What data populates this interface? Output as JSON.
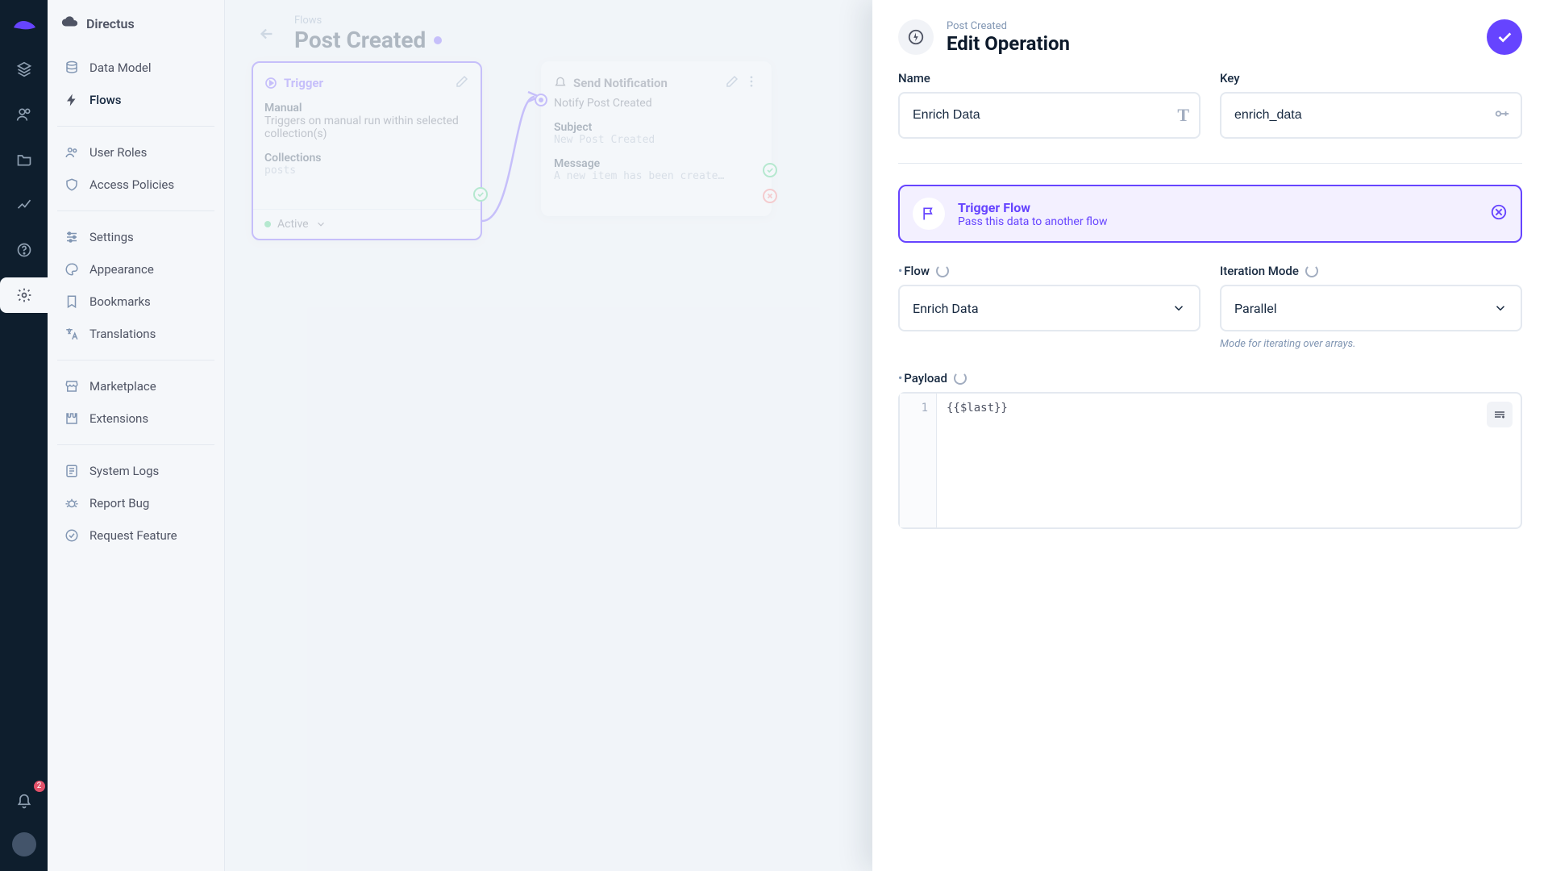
{
  "brand": "Directus",
  "notifications_count": "2",
  "rail": [
    "cube",
    "users",
    "people",
    "folder",
    "chart",
    "help",
    "settings"
  ],
  "sidebar": {
    "groups": [
      [
        {
          "icon": "data-model",
          "label": "Data Model"
        },
        {
          "icon": "bolt",
          "label": "Flows",
          "active": true
        }
      ],
      [
        {
          "icon": "roles",
          "label": "User Roles"
        },
        {
          "icon": "shield",
          "label": "Access Policies"
        }
      ],
      [
        {
          "icon": "sliders",
          "label": "Settings"
        },
        {
          "icon": "palette",
          "label": "Appearance"
        },
        {
          "icon": "bookmark",
          "label": "Bookmarks"
        },
        {
          "icon": "translate",
          "label": "Translations"
        }
      ],
      [
        {
          "icon": "store",
          "label": "Marketplace"
        },
        {
          "icon": "puzzle",
          "label": "Extensions"
        }
      ],
      [
        {
          "icon": "logs",
          "label": "System Logs"
        },
        {
          "icon": "bug",
          "label": "Report Bug"
        },
        {
          "icon": "idea",
          "label": "Request Feature"
        }
      ]
    ]
  },
  "page": {
    "breadcrumb": "Flows",
    "title": "Post Created",
    "status": "Active"
  },
  "nodes": {
    "trigger": {
      "title": "Trigger",
      "type": "Manual",
      "type_desc": "Triggers on manual run within selected collection(s)",
      "collections_label": "Collections",
      "collections_value": "posts"
    },
    "op1": {
      "title": "Send Notification",
      "subtitle": "Notify Post Created",
      "subject_label": "Subject",
      "subject_value": "New Post Created",
      "message_label": "Message",
      "message_value": "A new item has been create…"
    }
  },
  "drawer": {
    "eyebrow": "Post Created",
    "title": "Edit Operation",
    "name_label": "Name",
    "name_value": "Enrich Data",
    "key_label": "Key",
    "key_value": "enrich_data",
    "type_title": "Trigger Flow",
    "type_desc": "Pass this data to another flow",
    "flow_label": "Flow",
    "flow_value": "Enrich Data",
    "iter_label": "Iteration Mode",
    "iter_value": "Parallel",
    "iter_hint": "Mode for iterating over arrays.",
    "payload_label": "Payload",
    "payload_code": "{{$last}}",
    "payload_line": "1"
  }
}
